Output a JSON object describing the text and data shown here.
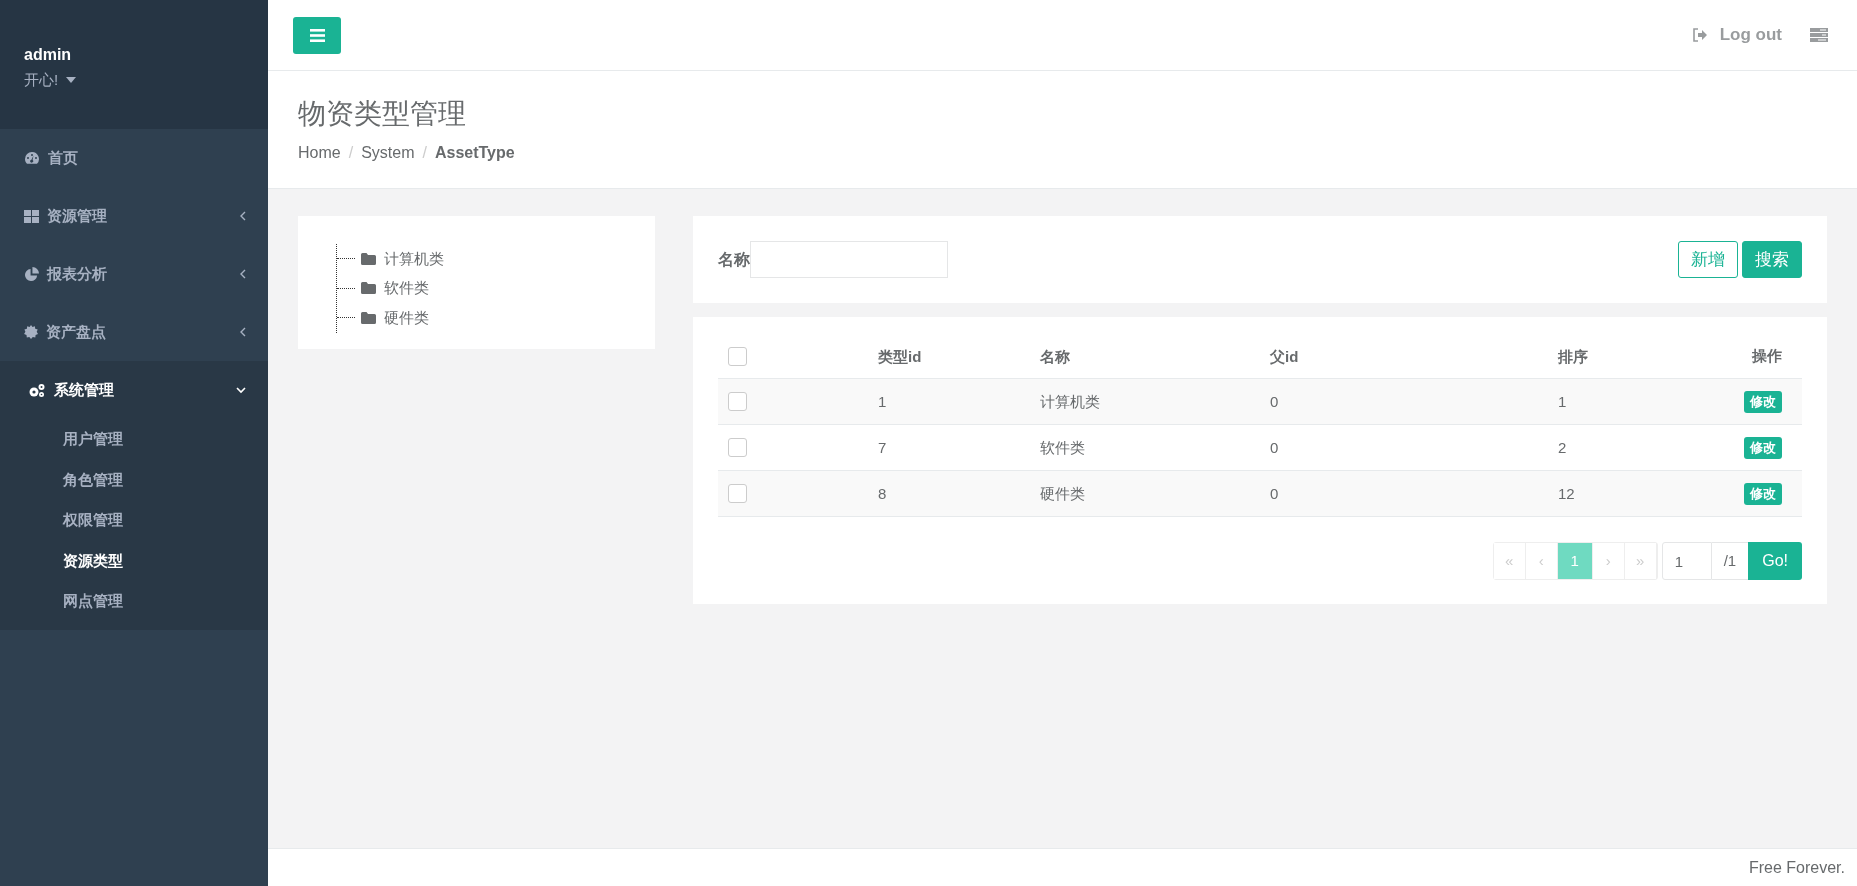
{
  "user": {
    "name": "admin",
    "mood": "开心!"
  },
  "menu": [
    {
      "label": "首页",
      "expanded": false
    },
    {
      "label": "资源管理",
      "expanded": false
    },
    {
      "label": "报表分析",
      "expanded": false
    },
    {
      "label": "资产盘点",
      "expanded": false
    },
    {
      "label": "系统管理",
      "expanded": true,
      "children": [
        {
          "label": "用户管理",
          "selected": false
        },
        {
          "label": "角色管理",
          "selected": false
        },
        {
          "label": "权限管理",
          "selected": false
        },
        {
          "label": "资源类型",
          "selected": true
        },
        {
          "label": "网点管理",
          "selected": false
        }
      ]
    }
  ],
  "topbar": {
    "logout": "Log out"
  },
  "page": {
    "title": "物资类型管理",
    "breadcrumb": [
      {
        "label": "Home",
        "separator": "/"
      },
      {
        "label": "System",
        "separator": "/"
      },
      {
        "label": "AssetType"
      }
    ]
  },
  "tree": {
    "children": [
      {
        "label": "计算机类"
      },
      {
        "label": "软件类"
      },
      {
        "label": "硬件类"
      }
    ]
  },
  "search": {
    "label": "名称",
    "buttons": [
      {
        "label": "新增",
        "kind": "outline"
      },
      {
        "label": "搜索",
        "kind": "primary"
      }
    ]
  },
  "table": {
    "all_checked": false,
    "columns": [
      "类型id",
      "名称",
      "父id",
      "排序",
      "操作"
    ],
    "rows": [
      {
        "checked": false,
        "cells": [
          "1",
          "计算机类",
          "0",
          "1"
        ],
        "action": "修改"
      },
      {
        "checked": false,
        "cells": [
          "7",
          "软件类",
          "0",
          "2"
        ],
        "action": "修改"
      },
      {
        "checked": false,
        "cells": [
          "8",
          "硬件类",
          "0",
          "12"
        ],
        "action": "修改"
      }
    ]
  },
  "pagination": {
    "pages": [
      {
        "label": "«",
        "selected": false
      },
      {
        "label": "‹",
        "selected": false
      },
      {
        "label": "1",
        "selected": true
      },
      {
        "label": "›",
        "selected": false
      },
      {
        "label": "»",
        "selected": false
      }
    ],
    "page_input": "1",
    "total": "/1",
    "go": "Go!"
  },
  "footer": "Free Forever."
}
